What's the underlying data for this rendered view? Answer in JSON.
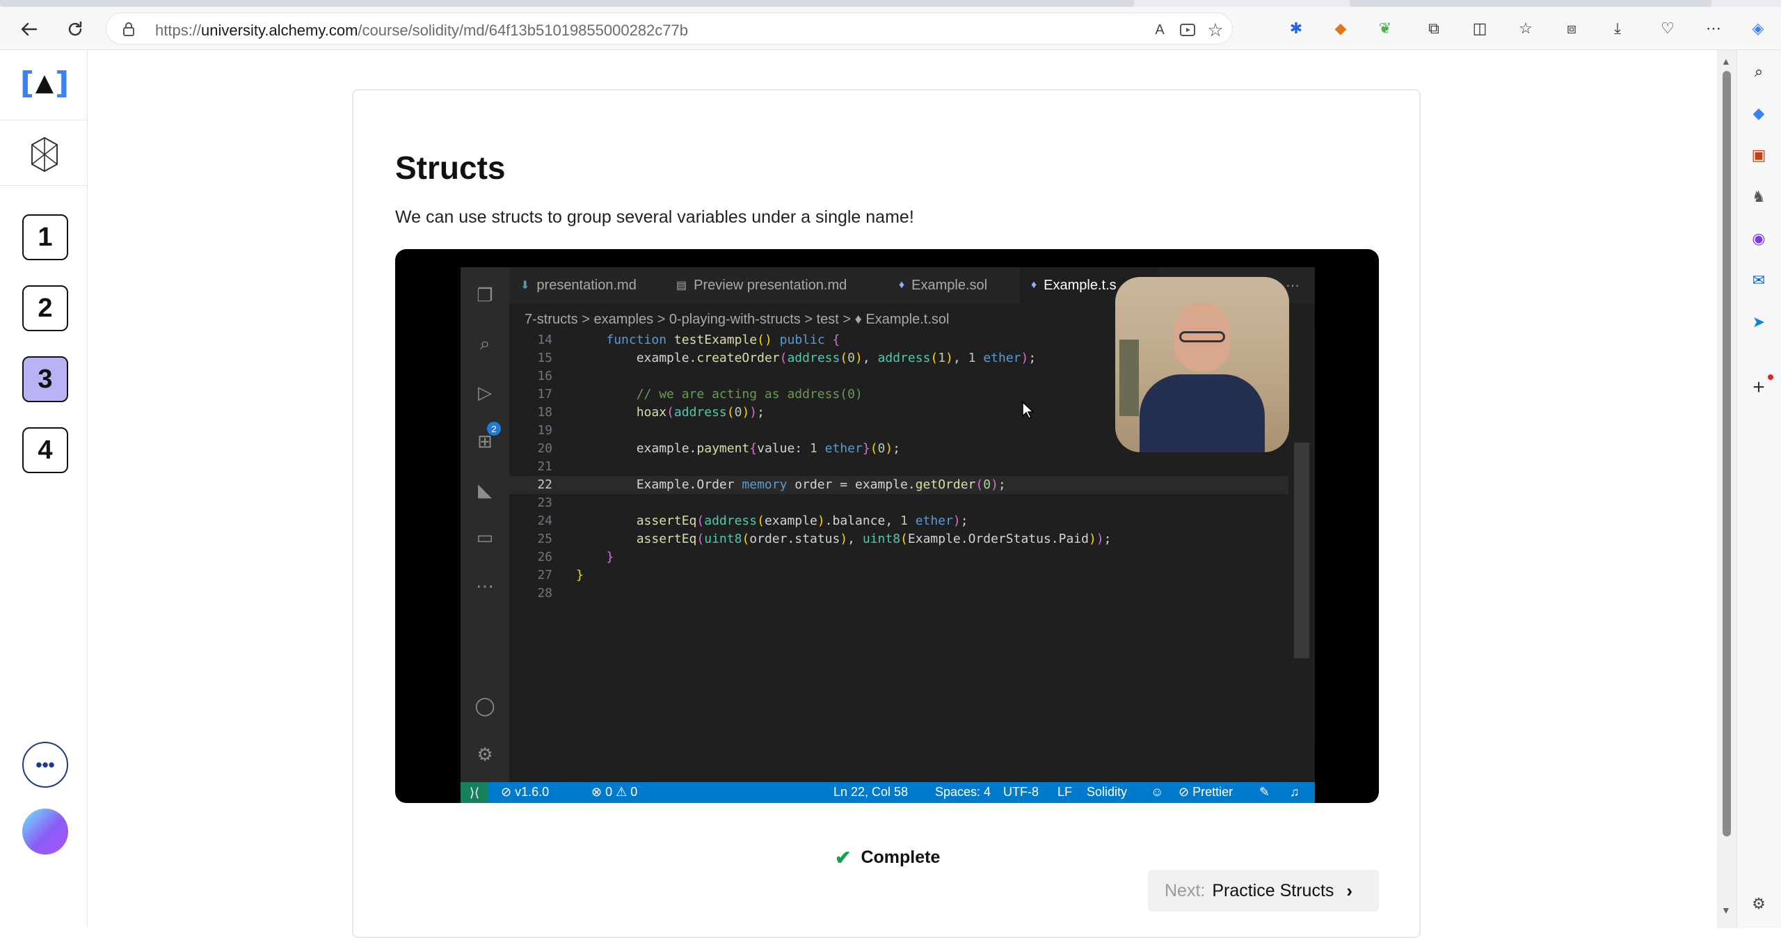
{
  "browser": {
    "url_prefix": "https://",
    "url_domain": "university.alchemy.com",
    "url_path": "/course/solidity/md/64f13b51019855000282c77b"
  },
  "sidebar": {
    "logo_left": "[",
    "logo_mark": "▲",
    "logo_right": "]",
    "steps": [
      "1",
      "2",
      "3",
      "4"
    ],
    "active_step": "3",
    "more": "•••"
  },
  "page": {
    "title": "Structs",
    "subtitle": "We can use structs to group several variables under a single name!"
  },
  "video": {
    "tabs": [
      "presentation.md",
      "Preview presentation.md",
      "Example.sol",
      "Example.t.s"
    ],
    "breadcrumb": "7-structs > examples > 0-playing-with-structs > test > ♦ Example.t.sol",
    "line_numbers": [
      "14",
      "15",
      "16",
      "17",
      "18",
      "19",
      "20",
      "21",
      "22",
      "23",
      "24",
      "25",
      "26",
      "27",
      "28"
    ],
    "current_line": "22",
    "activity_badge": "2",
    "status": {
      "version": "v1.6.0",
      "problems": "⊗ 0 ⚠ 0",
      "position": "Ln 22, Col 58",
      "spaces": "Spaces: 4",
      "encoding": "UTF-8",
      "eol": "LF",
      "language": "Solidity",
      "formatter": "⊘ Prettier"
    }
  },
  "actions": {
    "complete_label": "Complete",
    "next_prefix": "Next:",
    "next_label": "Practice Structs"
  }
}
